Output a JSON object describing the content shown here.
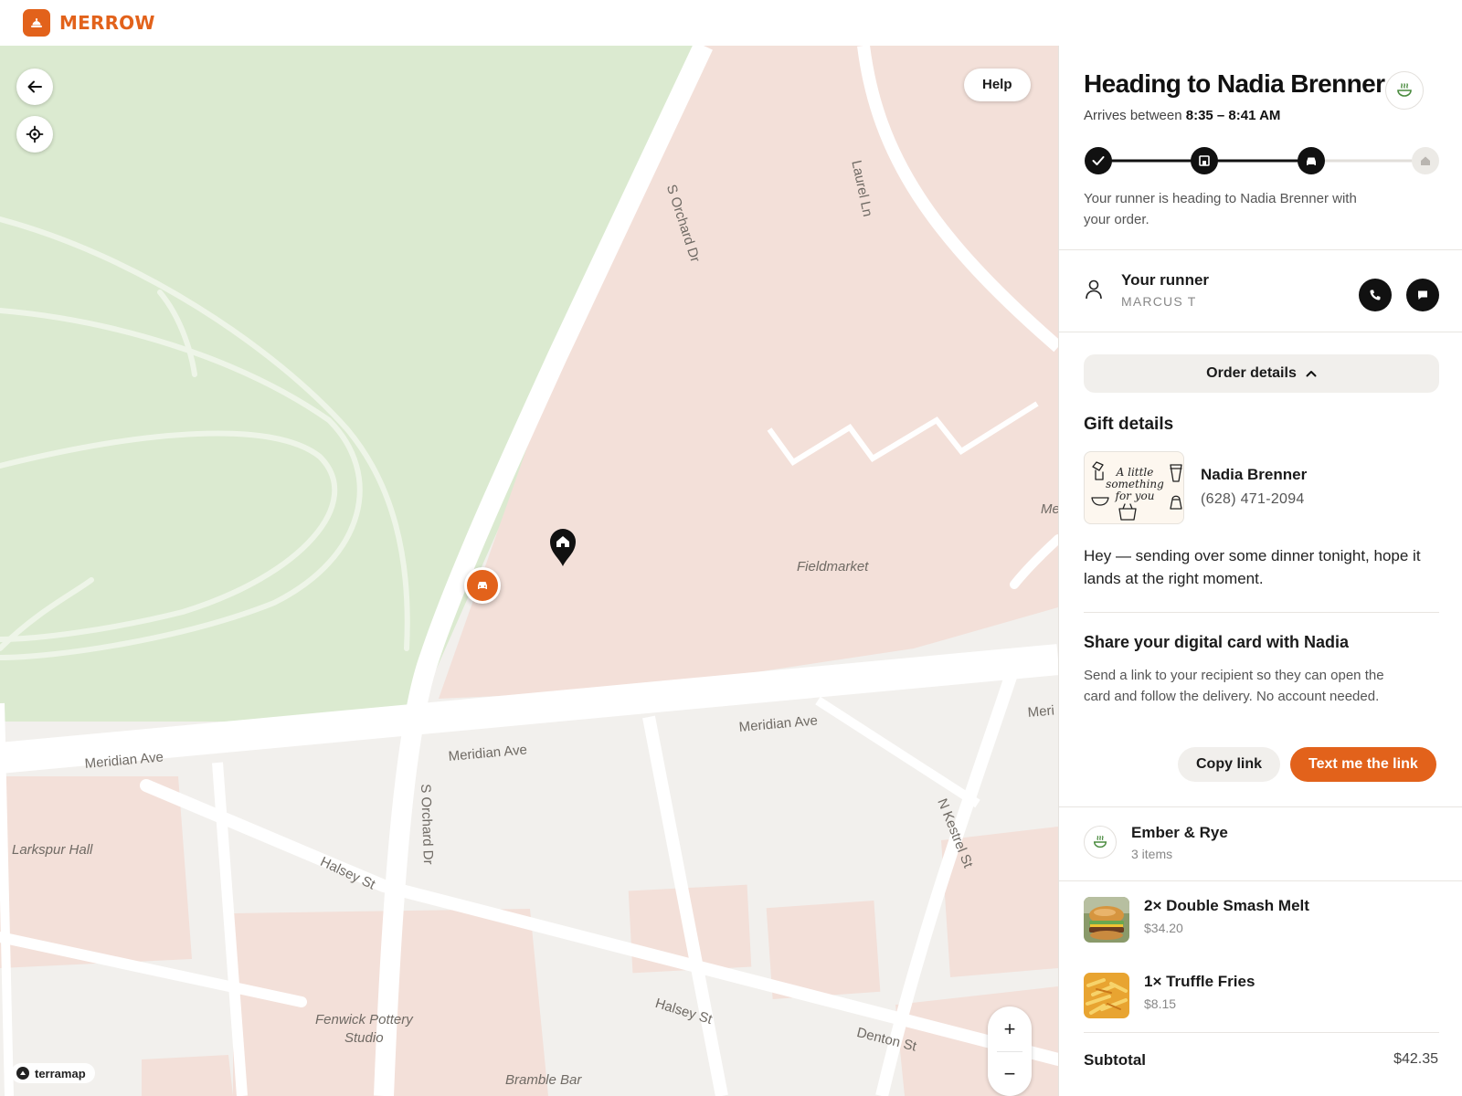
{
  "app": {
    "brand": "MERROW",
    "brand_color": "#e2621b"
  },
  "map": {
    "help_label": "Help",
    "attribution": "terramap",
    "labels": {
      "orchard_upper": "S Orchard Dr",
      "laurel": "Laurel Ln",
      "fieldmarket": "Fieldmarket",
      "meridian_west": "Meridian Ave",
      "meridian_mid": "Meridian Ave",
      "meridian_east": "Meridian Ave",
      "meridian_edge": "Meri",
      "me_edge": "Me",
      "orchard_lower": "S Orchard Dr",
      "larkspur": "Larkspur Hall",
      "halsey_west": "Halsey St",
      "halsey_east": "Halsey St",
      "kestrel": "N Kestrel St",
      "fenwick_1": "Fenwick Pottery",
      "fenwick_2": "Studio",
      "denton": "Denton St",
      "bramble": "Bramble Bar"
    },
    "zoom_in": "+",
    "zoom_out": "−"
  },
  "tracking": {
    "title": "Heading to Nadia Brenner",
    "eta_prefix": "Arrives between",
    "eta_window": "8:35 – 8:41 AM",
    "progress": {
      "steps": [
        "confirmed",
        "store",
        "on-the-way",
        "delivered"
      ],
      "completed_steps": 3
    },
    "status_text": "Your runner is heading to Nadia Brenner with your order."
  },
  "runner": {
    "title": "Your runner",
    "name": "MARCUS T"
  },
  "order_toggle": "Order details",
  "gift": {
    "title": "Gift details",
    "card_text": "A little something for you",
    "recipient_name": "Nadia Brenner",
    "recipient_phone": "(628) 471-2094",
    "message": "Hey — sending over some dinner tonight, hope it lands at the right moment."
  },
  "share": {
    "title": "Share your digital card with Nadia",
    "description": "Send a link to your recipient so they can open the card and follow the delivery. No account needed.",
    "copy_label": "Copy link",
    "text_label": "Text me the link"
  },
  "store": {
    "name": "Ember & Rye",
    "items_count": "3 items"
  },
  "items": [
    {
      "name": "2× Double Smash Melt",
      "price": "$34.20"
    },
    {
      "name": "1× Truffle Fries",
      "price": "$8.15"
    }
  ],
  "subtotal": {
    "label": "Subtotal",
    "value": "$42.35"
  }
}
